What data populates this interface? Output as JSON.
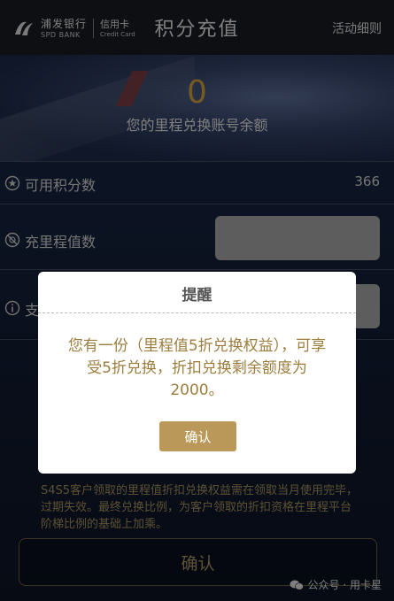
{
  "header": {
    "bank_name_cn": "浦发银行",
    "bank_name_en": "SPD BANK",
    "card_label_cn": "信用卡",
    "card_label_en": "Credit Card",
    "title": "积分充值",
    "detail_link": "活动细则"
  },
  "banner": {
    "balance": "0",
    "balance_label": "您的里程兑换账号余额"
  },
  "form": {
    "available_points_label": "可用积分数",
    "available_points_value": "366",
    "recharge_label": "充里程值数",
    "pay_label": "支"
  },
  "notes": {
    "text": "S4S5客户领取的里程值折扣兑换权益需在领取当月使用完毕，过期失效。最终兑换比例，为客户领取的折扣资格在里程平台阶梯比例的基础上加乘。"
  },
  "bottom": {
    "confirm_label": "确认"
  },
  "watermark": {
    "text": "公众号 · 用卡星"
  },
  "dialog": {
    "title": "提醒",
    "message": "您有一份（里程值5折兑换权益），可享受5折兑换，折扣兑换剩余额度为2000。",
    "confirm_label": "确认"
  },
  "colors": {
    "gold": "#b9985a",
    "balance": "#d9a53d",
    "header_bg": "#1a1d24"
  }
}
